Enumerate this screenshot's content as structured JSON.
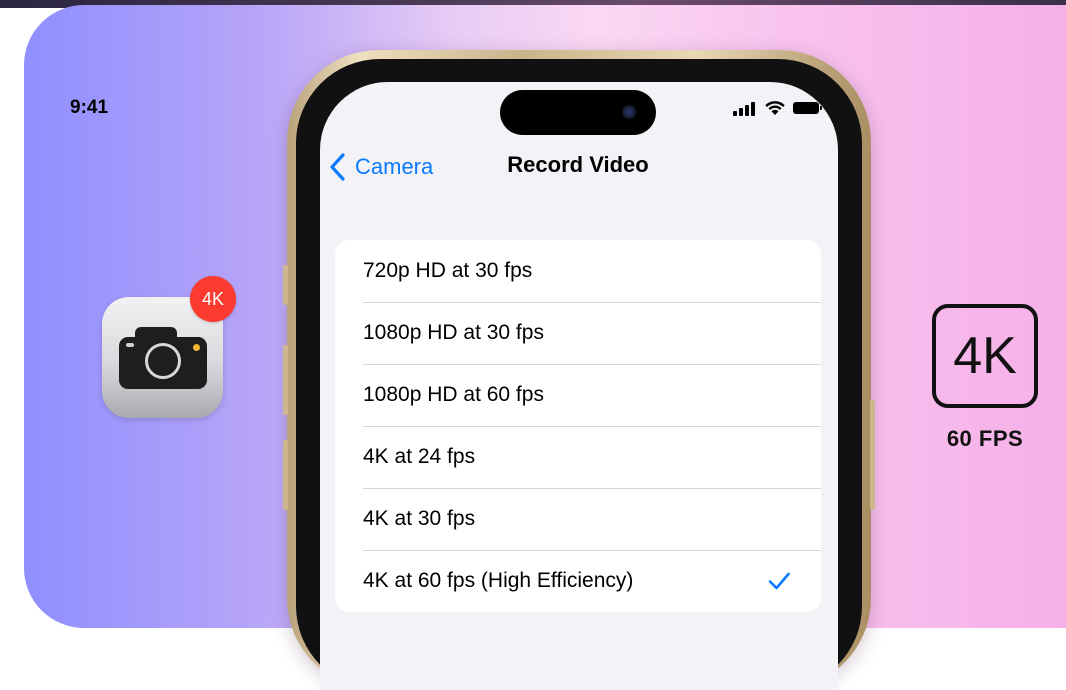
{
  "status_bar": {
    "time": "9:41"
  },
  "nav": {
    "back_label": "Camera",
    "title": "Record Video"
  },
  "options": [
    {
      "label": "720p HD at 30 fps",
      "selected": false
    },
    {
      "label": "1080p HD at 30 fps",
      "selected": false
    },
    {
      "label": "1080p HD at 60 fps",
      "selected": false
    },
    {
      "label": "4K at 24 fps",
      "selected": false
    },
    {
      "label": "4K at 30 fps",
      "selected": false
    },
    {
      "label": "4K at 60 fps (High Efficiency)",
      "selected": true
    }
  ],
  "app_icon": {
    "badge": "4K",
    "icon": "camera-icon"
  },
  "logo": {
    "resolution": "4K",
    "fps": "60 FPS"
  },
  "colors": {
    "accent": "#0a7aff",
    "badge": "#fb3b30",
    "screen_bg": "#f2f2f7",
    "banner_left": "#8f8ffe",
    "banner_right": "#f6b0e9"
  }
}
